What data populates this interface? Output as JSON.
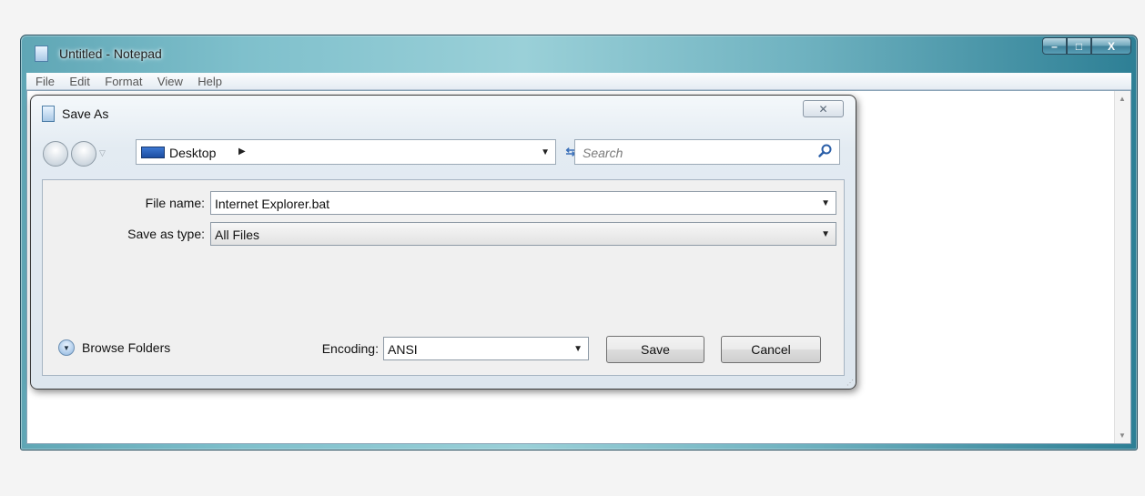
{
  "notepad": {
    "title": "Untitled - Notepad",
    "menu": [
      "File",
      "Edit",
      "Format",
      "View",
      "Help"
    ],
    "controls": {
      "minimize": "–",
      "maximize": "□",
      "close": "X"
    }
  },
  "dialog": {
    "title": "Save As",
    "close_glyph": "✕",
    "address": {
      "location": "Desktop",
      "separator": "▶",
      "dropdown": "▼"
    },
    "refresh_glyph": "⇆",
    "search": {
      "placeholder": "Search"
    },
    "file_name": {
      "label": "File name:",
      "value": "Internet Explorer.bat"
    },
    "save_as_type": {
      "label": "Save as type:",
      "value": "All Files"
    },
    "browse_folders": "Browse Folders",
    "encoding": {
      "label": "Encoding:",
      "value": "ANSI"
    },
    "buttons": {
      "save": "Save",
      "cancel": "Cancel"
    }
  },
  "icons": {
    "app": "notepad-icon",
    "back": "back-arrow-icon",
    "forward": "forward-arrow-icon",
    "desktop": "desktop-icon",
    "refresh": "refresh-icon",
    "search": "search-icon",
    "browse": "chevron-down-circle-icon"
  },
  "colors": {
    "title_bar_accent": "#6fb2c0",
    "link_blue": "#3a6fb8"
  }
}
